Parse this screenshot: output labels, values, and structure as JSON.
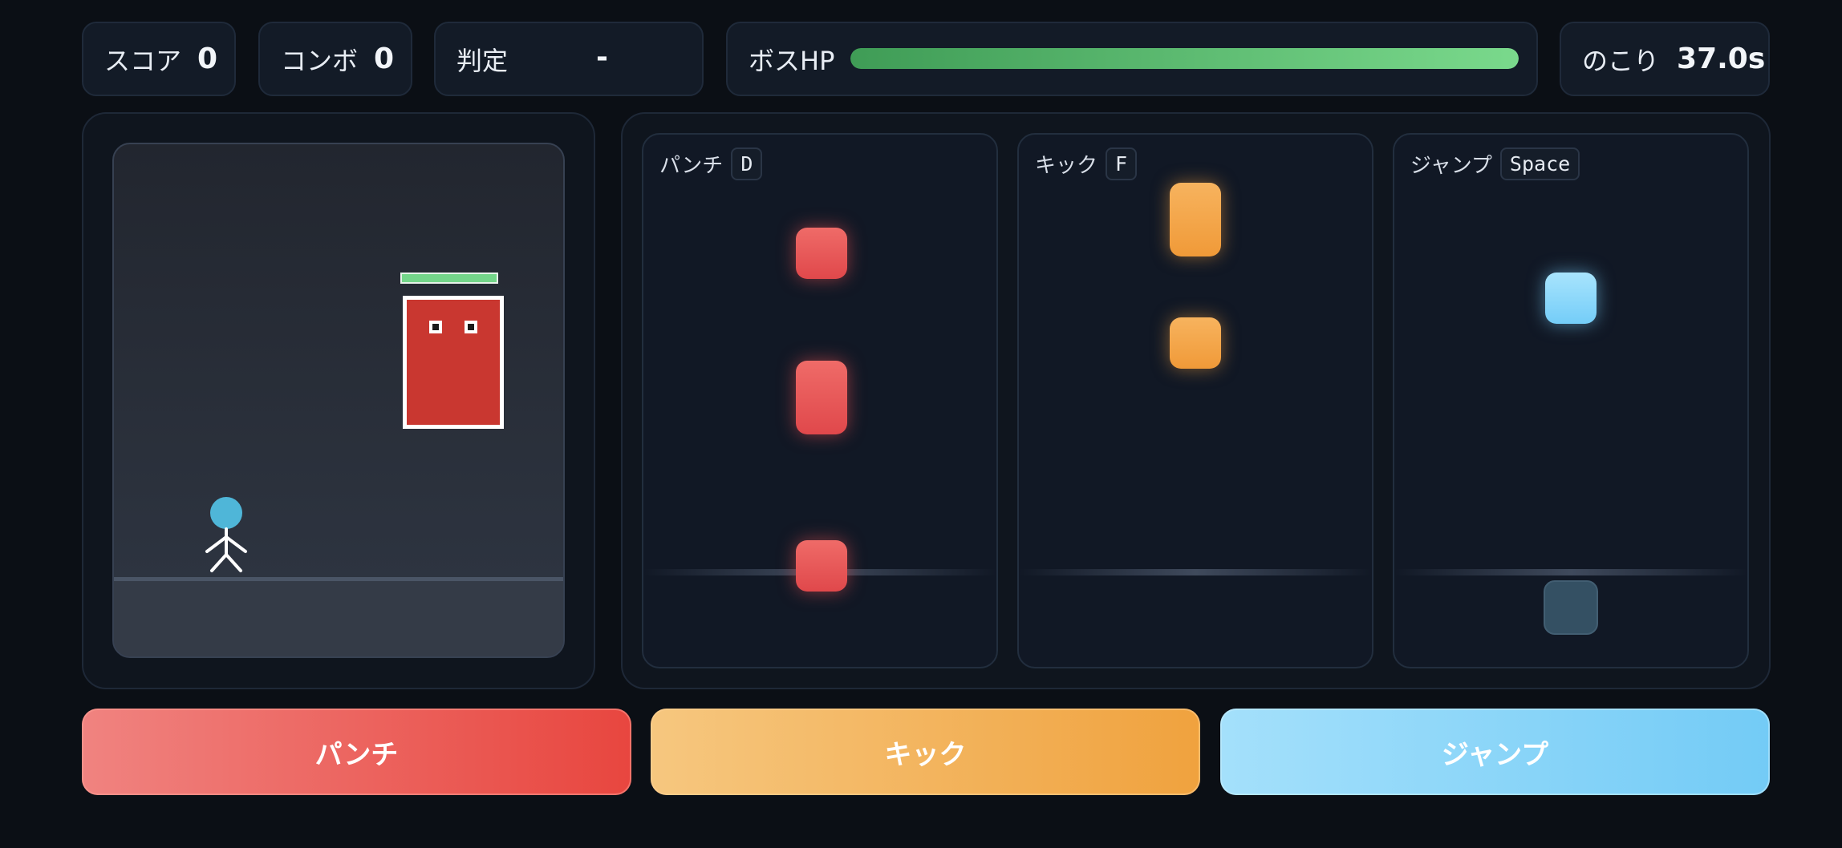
{
  "hud": {
    "score_label": "スコア",
    "score_value": "0",
    "combo_label": "コンボ",
    "combo_value": "0",
    "judge_label": "判定",
    "judge_value": "-",
    "boss_hp_label": "ボスHP",
    "boss_hp_percent": 100,
    "time_label": "のこり",
    "time_value": "37.0s"
  },
  "stage": {
    "boss_hp_percent": 100,
    "player_color": "#4fb6d8",
    "boss_color": "#c93730"
  },
  "lanes": [
    {
      "name": "パンチ",
      "key": "D",
      "color": "#e8544f"
    },
    {
      "name": "キック",
      "key": "F",
      "color": "#f2a642"
    },
    {
      "name": "ジャンプ",
      "key": "Space",
      "color": "#7fd0f8"
    }
  ],
  "buttons": {
    "punch": "パンチ",
    "kick": "キック",
    "jump": "ジャンプ"
  },
  "colors": {
    "background": "#0b0f15",
    "hp_bar": "#6dcf80"
  }
}
